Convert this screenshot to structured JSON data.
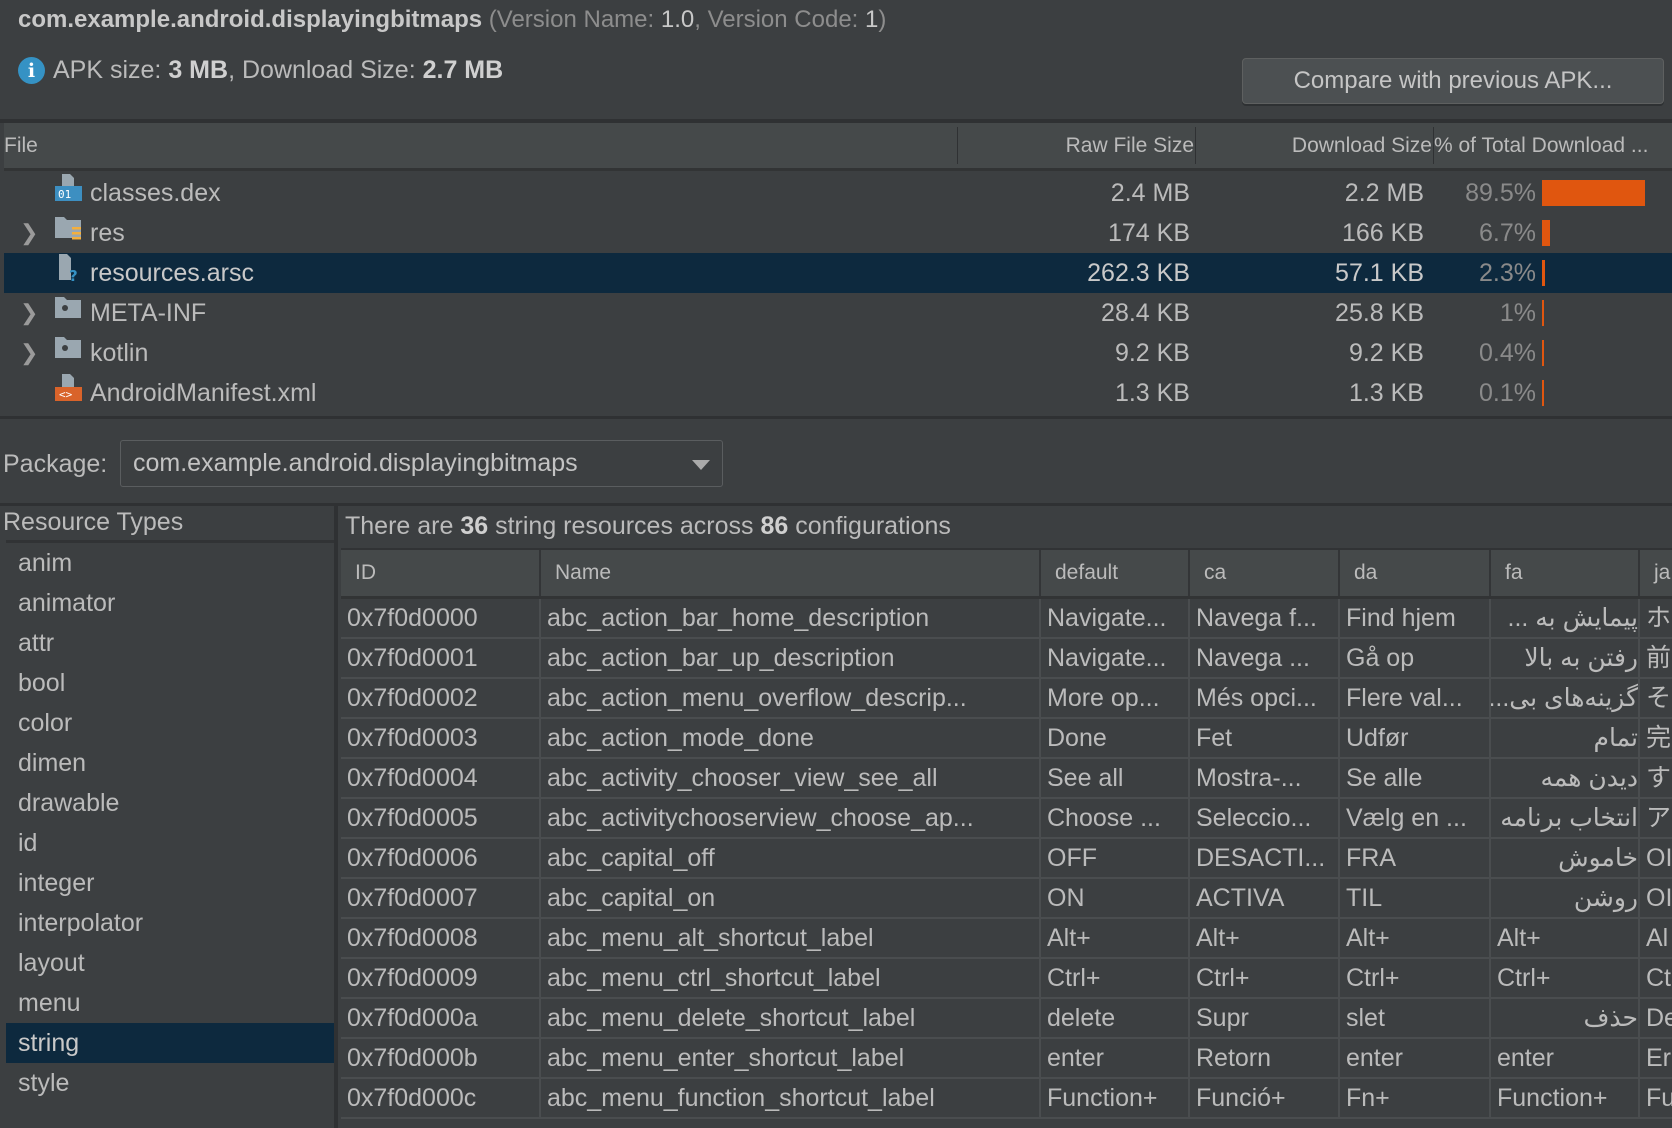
{
  "header": {
    "package": "com.example.android.displayingbitmaps",
    "version_prefix": "(Version Name: ",
    "version_name": "1.0",
    "version_mid": ", Version Code: ",
    "version_code": "1",
    "version_suffix": ")",
    "info_icon": "info-icon",
    "apk_size_label": "APK size: ",
    "apk_size": "3 MB",
    "download_size_label": ", Download Size: ",
    "download_size": "2.7 MB",
    "compare_button": "Compare with previous APK..."
  },
  "file_table": {
    "columns": [
      "File",
      "Raw File Size",
      "Download Size",
      "% of Total Download ..."
    ],
    "bar_color": "#e0560f",
    "selected_color": "#0d293e",
    "rows": [
      {
        "name": "classes.dex",
        "icon": "dex-file-icon",
        "expandable": false,
        "raw": "2.4 MB",
        "download": "2.2 MB",
        "pct_label": "89.5%",
        "pct": 89.5
      },
      {
        "name": "res",
        "icon": "res-folder-icon",
        "expandable": true,
        "raw": "174 KB",
        "download": "166 KB",
        "pct_label": "6.7%",
        "pct": 6.7
      },
      {
        "name": "resources.arsc",
        "icon": "unknown-file-icon",
        "expandable": false,
        "raw": "262.3 KB",
        "download": "57.1 KB",
        "pct_label": "2.3%",
        "pct": 2.3,
        "selected": true
      },
      {
        "name": "META-INF",
        "icon": "folder-icon",
        "expandable": true,
        "raw": "28.4 KB",
        "download": "25.8 KB",
        "pct_label": "1%",
        "pct": 1
      },
      {
        "name": "kotlin",
        "icon": "folder-icon",
        "expandable": true,
        "raw": "9.2 KB",
        "download": "9.2 KB",
        "pct_label": "0.4%",
        "pct": 0.4
      },
      {
        "name": "AndroidManifest.xml",
        "icon": "xml-file-icon",
        "expandable": false,
        "raw": "1.3 KB",
        "download": "1.3 KB",
        "pct_label": "0.1%",
        "pct": 0.1
      }
    ]
  },
  "package_selector": {
    "label": "Package:",
    "value": "com.example.android.displayingbitmaps"
  },
  "resource_types": {
    "label": "Resource Types",
    "items": [
      "anim",
      "animator",
      "attr",
      "bool",
      "color",
      "dimen",
      "drawable",
      "id",
      "integer",
      "interpolator",
      "layout",
      "menu",
      "string",
      "style"
    ],
    "selected": "string"
  },
  "summary": {
    "prefix": "There are ",
    "count": "36",
    "middle": " string resources across ",
    "configs": "86",
    "suffix": " configurations"
  },
  "string_table": {
    "columns": [
      "ID",
      "Name",
      "default",
      "ca",
      "da",
      "fa",
      "ja"
    ],
    "rows": [
      [
        "0x7f0d0000",
        "abc_action_bar_home_description",
        "Navigate...",
        "Navega f...",
        "Find hjem",
        "پیمایش به ...",
        "ホ"
      ],
      [
        "0x7f0d0001",
        "abc_action_bar_up_description",
        "Navigate...",
        "Navega ...",
        "Gå op",
        "رفتن به بالا",
        "前"
      ],
      [
        "0x7f0d0002",
        "abc_action_menu_overflow_descrip...",
        "More op...",
        "Més opci...",
        "Flere val...",
        "گزینه‌های بی...",
        "そ"
      ],
      [
        "0x7f0d0003",
        "abc_action_mode_done",
        "Done",
        "Fet",
        "Udfør",
        "تمام",
        "完"
      ],
      [
        "0x7f0d0004",
        "abc_activity_chooser_view_see_all",
        "See all",
        "Mostra-...",
        "Se alle",
        "دیدن همه",
        "す"
      ],
      [
        "0x7f0d0005",
        "abc_activitychooserview_choose_ap...",
        "Choose ...",
        "Seleccio...",
        "Vælg en ...",
        "انتخاب برنامه",
        "ア"
      ],
      [
        "0x7f0d0006",
        "abc_capital_off",
        "OFF",
        "DESACTI...",
        "FRA",
        "خاموش",
        "OI"
      ],
      [
        "0x7f0d0007",
        "abc_capital_on",
        "ON",
        "ACTIVA",
        "TIL",
        "روشن",
        "OI"
      ],
      [
        "0x7f0d0008",
        "abc_menu_alt_shortcut_label",
        "Alt+",
        "Alt+",
        "Alt+",
        "Alt+",
        "Al"
      ],
      [
        "0x7f0d0009",
        "abc_menu_ctrl_shortcut_label",
        "Ctrl+",
        "Ctrl+",
        "Ctrl+",
        "Ctrl+",
        "Ct"
      ],
      [
        "0x7f0d000a",
        "abc_menu_delete_shortcut_label",
        "delete",
        "Supr",
        "slet",
        "حذف",
        "De"
      ],
      [
        "0x7f0d000b",
        "abc_menu_enter_shortcut_label",
        "enter",
        "Retorn",
        "enter",
        "enter",
        "Er"
      ],
      [
        "0x7f0d000c",
        "abc_menu_function_shortcut_label",
        "Function+",
        "Funció+",
        "Fn+",
        "Function+",
        "Fu"
      ]
    ]
  }
}
